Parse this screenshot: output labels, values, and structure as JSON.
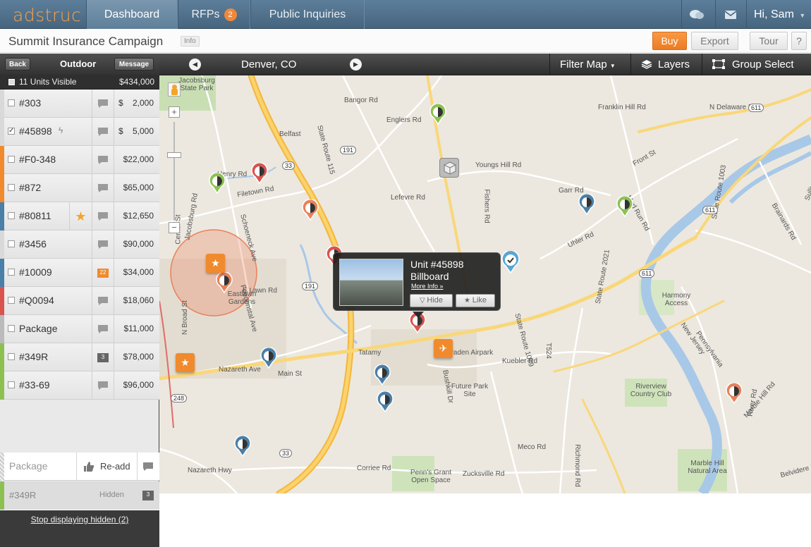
{
  "app": {
    "logo": "adstruc",
    "tabs": [
      {
        "label": "Dashboard"
      },
      {
        "label": "RFPs",
        "badge": "2"
      },
      {
        "label": "Public Inquiries"
      }
    ],
    "user_greeting": "Hi, Sam",
    "icons": [
      "chat-icon",
      "mail-icon",
      "caret-down-icon"
    ]
  },
  "subbar": {
    "title": "Summit Insurance Campaign",
    "info_tag": "Info",
    "buy": "Buy",
    "export": "Export",
    "tour": "Tour",
    "help": "?"
  },
  "sidebar": {
    "back": "Back",
    "title": "Outdoor",
    "message": "Message",
    "units_visible": "11 Units Visible",
    "total": "$434,000",
    "rows": [
      {
        "id": "#303",
        "currency": "$",
        "price": "2,000",
        "checked": false,
        "stripe": "#d9d9d9"
      },
      {
        "id": "#45898",
        "currency": "$",
        "price": "5,000",
        "checked": true,
        "stripe": "#d9d9d9"
      },
      {
        "id": "#F0-348",
        "currency": "",
        "price": "$22,000",
        "checked": false,
        "stripe": "#f08a2c"
      },
      {
        "id": "#872",
        "currency": "",
        "price": "$65,000",
        "checked": false,
        "stripe": "#f08a2c"
      },
      {
        "id": "#80811",
        "currency": "",
        "price": "$12,650",
        "checked": false,
        "stripe": "#4a7fa8"
      },
      {
        "id": "#3456",
        "currency": "",
        "price": "$90,000",
        "checked": false,
        "stripe": "#d9d9d9"
      },
      {
        "id": "#10009",
        "currency": "",
        "price": "$34,000",
        "checked": false,
        "stripe": "#4a7fa8",
        "comments": "22"
      },
      {
        "id": "#Q0094",
        "currency": "",
        "price": "$18,060",
        "checked": false,
        "stripe": "#d9534f"
      },
      {
        "id": "Package",
        "currency": "",
        "price": "$11,000",
        "checked": false,
        "stripe": "#bbbbbb"
      },
      {
        "id": "#349R",
        "currency": "",
        "price": "$78,000",
        "checked": false,
        "stripe": "#8cc152",
        "comments": "3"
      },
      {
        "id": "#33-69",
        "currency": "",
        "price": "$96,000",
        "checked": false,
        "stripe": "#8cc152"
      }
    ],
    "readd_row": {
      "id": "Package",
      "action": "Re-add"
    },
    "hidden_row": {
      "id": "#349R",
      "status": "Hidden",
      "comments": "3"
    },
    "stop_hidden": "Stop displaying hidden (2)"
  },
  "maptoolbar": {
    "city": "Denver, CO",
    "filter": "Filter Map",
    "layers": "Layers",
    "group_select": "Group Select"
  },
  "popup": {
    "unit": "Unit #45898",
    "type": "Billboard",
    "more": "More Info »",
    "hide": "Hide",
    "like": "Like"
  },
  "map": {
    "labels": [
      {
        "t": "Jacobsburg State Park"
      },
      {
        "t": "Belfast"
      },
      {
        "t": "Henry Rd"
      },
      {
        "t": "Filetown Rd"
      },
      {
        "t": "Englers Rd"
      },
      {
        "t": "Bangor Rd"
      },
      {
        "t": "Lefevre Rd"
      },
      {
        "t": "Youngs Hill Rd"
      },
      {
        "t": "Garr Rd"
      },
      {
        "t": "N Delaware Dr"
      },
      {
        "t": "Franklin Hill Rd"
      },
      {
        "t": "Front St"
      },
      {
        "t": "Uhler Rd"
      },
      {
        "t": "Mud Run Rd"
      },
      {
        "t": "Harmony Access"
      },
      {
        "t": "E Lawn Rd"
      },
      {
        "t": "Eastlawn Gardens"
      },
      {
        "t": "Nazareth Ave"
      },
      {
        "t": "Main St"
      },
      {
        "t": "Tatamy"
      },
      {
        "t": "Braden Airpark"
      },
      {
        "t": "Kuebler Rd"
      },
      {
        "t": "Future Park Site"
      },
      {
        "t": "Riverview Country Club"
      },
      {
        "t": "Marble Hill Natural Area"
      },
      {
        "t": "Penn's Grant Open Space"
      },
      {
        "t": "Corriee Rd"
      },
      {
        "t": "Zucksville Rd"
      },
      {
        "t": "Meco Rd"
      },
      {
        "t": "Nazareth Hwy"
      },
      {
        "t": "Jacobsburg Rd"
      },
      {
        "t": "State Route 115"
      },
      {
        "t": "State Route 2021"
      },
      {
        "t": "State Route 1009"
      },
      {
        "t": "N Broad St"
      },
      {
        "t": "Center St"
      },
      {
        "t": "Schoeneck Ave"
      },
      {
        "t": "Friedenstal Ave"
      },
      {
        "t": "Bushkill Dr"
      },
      {
        "t": "Richmond Rd"
      },
      {
        "t": "River Rd"
      },
      {
        "t": "Brainards Rd"
      },
      {
        "t": "Belvidere Rd"
      },
      {
        "t": "Marble Hill Rd"
      },
      {
        "t": "New Jersey"
      },
      {
        "t": "Pennsylvania"
      },
      {
        "t": "Sullivan Trail"
      },
      {
        "t": "State Route 1003"
      },
      {
        "t": "Fishers Rd"
      },
      {
        "t": "T524"
      }
    ],
    "shields": [
      "191",
      "33",
      "611",
      "248"
    ]
  }
}
